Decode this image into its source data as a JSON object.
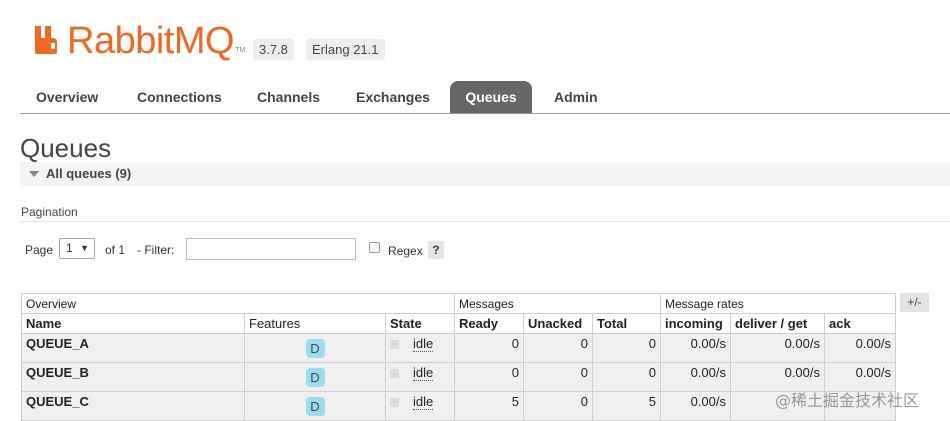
{
  "brand": {
    "name_rabbit": "Rabbit",
    "name_mq": "MQ",
    "tm": "TM",
    "color": "#f26822"
  },
  "versions": {
    "rabbitmq": "3.7.8",
    "erlang": "Erlang 21.1"
  },
  "tabs": [
    {
      "label": "Overview",
      "active": false
    },
    {
      "label": "Connections",
      "active": false
    },
    {
      "label": "Channels",
      "active": false
    },
    {
      "label": "Exchanges",
      "active": false
    },
    {
      "label": "Queues",
      "active": true
    },
    {
      "label": "Admin",
      "active": false
    }
  ],
  "page": {
    "title": "Queues",
    "section": "All queues (9)",
    "pagination_label": "Pagination"
  },
  "filters": {
    "page_label": "Page",
    "page_value": "1",
    "of_label": "of 1",
    "filter_label": "- Filter:",
    "filter_value": "",
    "regex_label": "Regex",
    "help": "?"
  },
  "table": {
    "groups": {
      "overview": "Overview",
      "messages": "Messages",
      "rates": "Message rates"
    },
    "columns": {
      "name": "Name",
      "features": "Features",
      "state": "State",
      "ready": "Ready",
      "unacked": "Unacked",
      "total": "Total",
      "incoming": "incoming",
      "deliver": "deliver / get",
      "ack": "ack"
    },
    "plusminus": "+/-",
    "rows": [
      {
        "name": "QUEUE_A",
        "feature": "D",
        "state": "idle",
        "ready": "0",
        "unacked": "0",
        "total": "0",
        "incoming": "0.00/s",
        "deliver": "0.00/s",
        "ack": "0.00/s"
      },
      {
        "name": "QUEUE_B",
        "feature": "D",
        "state": "idle",
        "ready": "0",
        "unacked": "0",
        "total": "0",
        "incoming": "0.00/s",
        "deliver": "0.00/s",
        "ack": "0.00/s"
      },
      {
        "name": "QUEUE_C",
        "feature": "D",
        "state": "idle",
        "ready": "5",
        "unacked": "0",
        "total": "5",
        "incoming": "0.00/s",
        "deliver": "",
        "ack": ""
      }
    ]
  },
  "watermark": "@稀土掘金技术社区"
}
